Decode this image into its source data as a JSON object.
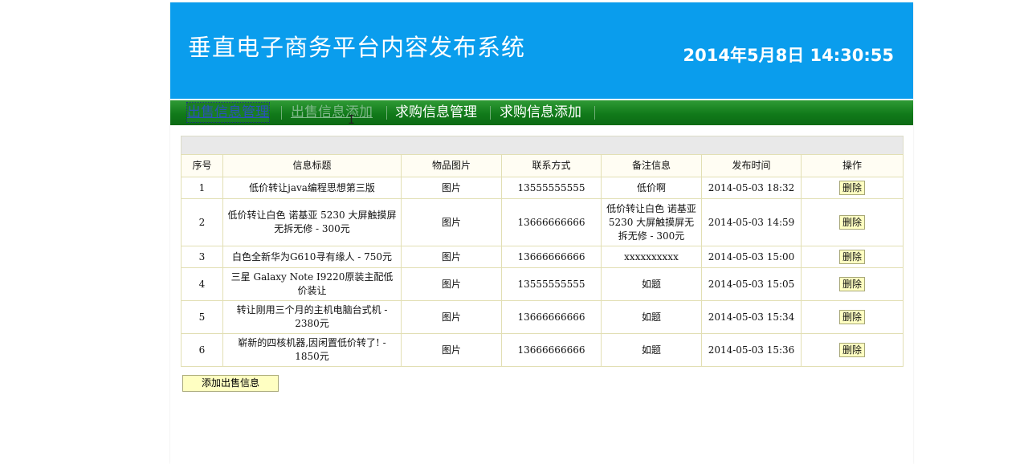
{
  "header": {
    "title": "垂直电子商务平台内容发布系统",
    "datetime": "2014年5月8日  14:30:55"
  },
  "nav": {
    "items": [
      {
        "label": "出售信息管理"
      },
      {
        "label": "出售信息添加"
      },
      {
        "label": "求购信息管理"
      },
      {
        "label": "求购信息添加"
      }
    ]
  },
  "table": {
    "headers": [
      "序号",
      "信息标题",
      "物品图片",
      "联系方式",
      "备注信息",
      "发布时间",
      "操作"
    ],
    "rows": [
      {
        "no": "1",
        "title": "低价转让java编程思想第三版",
        "image": "图片",
        "contact": "13555555555",
        "note": "低价啊",
        "time": "2014-05-03 18:32",
        "action": "删除"
      },
      {
        "no": "2",
        "title": "低价转让白色  诺基亚  5230 大屏触摸屏无拆无修  - 300元",
        "image": "图片",
        "contact": "13666666666",
        "note": "低价转让白色  诺基亚  5230 大屏触摸屏无拆无修  - 300元",
        "time": "2014-05-03 14:59",
        "action": "删除"
      },
      {
        "no": "3",
        "title": "白色全新华为G610寻有缘人  - 750元",
        "image": "图片",
        "contact": "13666666666",
        "note": "xxxxxxxxxx",
        "time": "2014-05-03 15:00",
        "action": "删除"
      },
      {
        "no": "4",
        "title": "三星  Galaxy Note I9220原装主配低价装让",
        "image": "图片",
        "contact": "13555555555",
        "note": "如题",
        "time": "2014-05-03 15:05",
        "action": "删除"
      },
      {
        "no": "5",
        "title": "转让刚用三个月的主机电脑台式机  - 2380元",
        "image": "图片",
        "contact": "13666666666",
        "note": "如题",
        "time": "2014-05-03 15:34",
        "action": "删除"
      },
      {
        "no": "6",
        "title": "崭新的四核机器,因闲置低价转了! - 1850元",
        "image": "图片",
        "contact": "13666666666",
        "note": "如题",
        "time": "2014-05-03 15:36",
        "action": "删除"
      }
    ]
  },
  "add_button": {
    "label": "添加出售信息"
  },
  "colors": {
    "header_bg": "#0a9ded",
    "nav_bg": "#117a1a",
    "button_bg": "#ffffc2",
    "border": "#e2dfb4"
  }
}
